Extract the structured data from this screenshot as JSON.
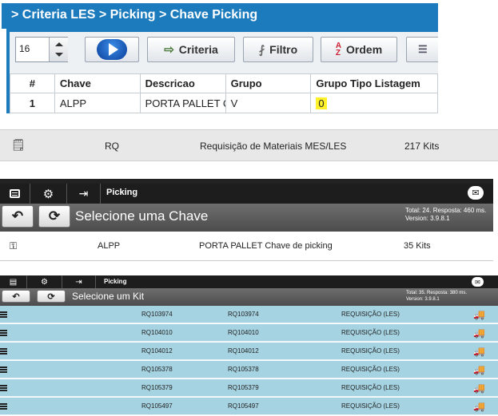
{
  "panel1": {
    "breadcrumb": "> Criteria LES > Picking > Chave Picking",
    "spinner_value": "16",
    "buttons": {
      "criteria": "Criteria",
      "filtro": "Filtro",
      "ordem": "Ordem"
    },
    "columns": [
      "#",
      "Chave",
      "Descricao",
      "Grupo",
      "Grupo Tipo Listagem"
    ],
    "rows": [
      {
        "num": "1",
        "chave": "ALPP",
        "descricao": "PORTA PALLET CH",
        "grupo": "V",
        "grupo_tipo": "0"
      }
    ]
  },
  "panel2": {
    "code": "RQ",
    "desc": "Requisição de Materiais MES/LES",
    "count": "217 Kits"
  },
  "panel3": {
    "nav_label": "Picking",
    "title": "Selecione uma Chave",
    "stats_line1": "Total: 24. Resposta: 460 ms.",
    "stats_line2": "Version: 3.9.8.1",
    "row": {
      "code": "ALPP",
      "desc": "PORTA PALLET Chave de picking",
      "count": "35 Kits"
    }
  },
  "panel4": {
    "nav_label": "Picking",
    "title": "Selecione um Kit",
    "stats_line1": "Total: 35. Resposta: 380 ms.",
    "stats_line2": "Version: 3.9.8.1",
    "rows": [
      {
        "a": "RQ103974",
        "b": "RQ103974",
        "type": "REQUISIÇÃO (LES)"
      },
      {
        "a": "RQ104010",
        "b": "RQ104010",
        "type": "REQUISIÇÃO (LES)"
      },
      {
        "a": "RQ104012",
        "b": "RQ104012",
        "type": "REQUISIÇÃO (LES)"
      },
      {
        "a": "RQ105378",
        "b": "RQ105378",
        "type": "REQUISIÇÃO (LES)"
      },
      {
        "a": "RQ105379",
        "b": "RQ105379",
        "type": "REQUISIÇÃO (LES)"
      },
      {
        "a": "RQ105497",
        "b": "RQ105497",
        "type": "REQUISIÇÃO (LES)"
      }
    ]
  },
  "icons": {
    "clipboard": "clipboard-icon",
    "key": "key-icon",
    "menu": "menu-icon",
    "gear": "gear-icon",
    "logout": "logout-icon",
    "mail": "mail-icon",
    "back": "back-arrow-icon",
    "refresh": "refresh-icon",
    "truck": "truck-icon"
  },
  "colors": {
    "accent_blue": "#1c7bbd",
    "highlight": "#fff12a",
    "row_blue": "#a5d3e1",
    "dark_bar": "#1d1d1d"
  }
}
